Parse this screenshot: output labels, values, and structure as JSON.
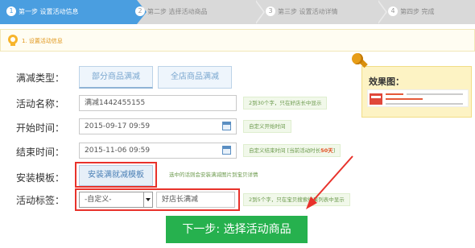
{
  "steps": [
    {
      "num": "1",
      "label": "第一步 设置活动信息",
      "active": true
    },
    {
      "num": "2",
      "label": "第二步 选择活动商品",
      "active": false
    },
    {
      "num": "3",
      "label": "第三步 设置活动详情",
      "active": false
    },
    {
      "num": "4",
      "label": "第四步 完成",
      "active": false
    }
  ],
  "section": {
    "title": "1. 设置活动信息"
  },
  "form": {
    "discount_type": {
      "label": "满减类型：",
      "options": [
        "部分商品满减",
        "全店商品满减"
      ],
      "selected": "部分商品满减"
    },
    "activity_name": {
      "label": "活动名称：",
      "value": "满减1442455155",
      "hint": "2到30个字，只在好店长中显示"
    },
    "start_time": {
      "label": "开始时间：",
      "value": "2015-09-17 09:59",
      "hint": "自定义开始时间"
    },
    "end_time": {
      "label": "结束时间：",
      "value": "2015-11-06 09:59",
      "hint_prefix": "自定义结束时间 [当前活动时长",
      "hint_days": "50天",
      "hint_suffix": "]"
    },
    "template": {
      "label": "安装模板：",
      "button": "安装满就减模板",
      "hint": "选中的话则会安装满减图片到宝贝详情"
    },
    "tag": {
      "label": "活动标签：",
      "select_value": "-自定义-",
      "input_value": "好店长满减",
      "hint": "2到5个字，只在宝贝搜索结果列表中显示"
    }
  },
  "preview": {
    "title": "效果图："
  },
  "next_button": "下一步: 选择活动商品",
  "colors": {
    "step_active": "#4a9ee0",
    "highlight": "#e8322b",
    "primary_button": "#26b14e",
    "hint_text": "#6c9a4d",
    "accent_orange": "#e0961b"
  }
}
